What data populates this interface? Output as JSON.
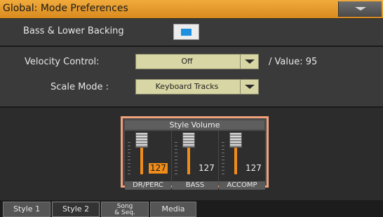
{
  "title": "Global: Mode Preferences",
  "header": {
    "menu_icon": "chevron-down-icon"
  },
  "bass_lower": {
    "label": "Bass & Lower Backing",
    "checked": true,
    "color": "#1e90e0"
  },
  "velocity": {
    "label": "Velocity Control:",
    "value": "Off",
    "value_label": "/ Value: 95"
  },
  "scale_mode": {
    "label": "Scale Mode :",
    "value": "Keyboard Tracks"
  },
  "style_volume": {
    "title": "Style Volume",
    "channels": [
      {
        "name": "DR/PERC",
        "value": "127",
        "level": 127
      },
      {
        "name": "BASS",
        "value": "127",
        "level": 127
      },
      {
        "name": "ACCOMP",
        "value": "127",
        "level": 127
      }
    ]
  },
  "tabs": [
    {
      "label": "Style 1",
      "active": false
    },
    {
      "label": "Style 2",
      "active": true
    },
    {
      "label": "Song & Seq.",
      "line1": "Song",
      "line2": "& Seq.",
      "active": false
    },
    {
      "label": "Media",
      "active": false
    }
  ],
  "colors": {
    "accent": "#f0aa3c",
    "highlight": "#f08c1a",
    "frame": "#f0a07a"
  }
}
